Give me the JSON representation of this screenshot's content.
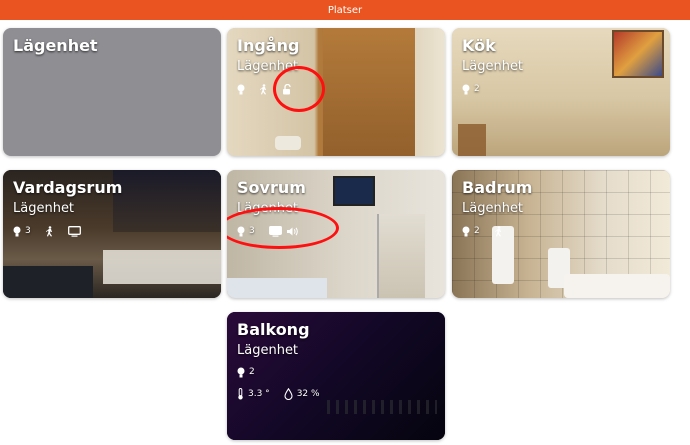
{
  "window": {
    "title": "Platser"
  },
  "colors": {
    "titlebar": "#e95420",
    "annotation": "#ff1010",
    "empty_card": "#8e8e93"
  },
  "cards": [
    {
      "name": "Lägenhet",
      "sub": "",
      "icons": []
    },
    {
      "name": "Ingång",
      "sub": "Lägenhet",
      "icons": [
        "lightbulb-icon",
        "motion-icon",
        "unlocked-padlock-icon"
      ]
    },
    {
      "name": "Kök",
      "sub": "Lägenhet",
      "lights": "2"
    },
    {
      "name": "Vardagsrum",
      "sub": "Lägenhet",
      "lights": "3",
      "icons": [
        "lightbulb-icon",
        "motion-icon",
        "tv-icon"
      ]
    },
    {
      "name": "Sovrum",
      "sub": "Lägenhet",
      "lights": "3",
      "icons": [
        "lightbulb-icon",
        "tv-icon",
        "speaker-icon"
      ]
    },
    {
      "name": "Badrum",
      "sub": "Lägenhet",
      "lights": "2",
      "icons": [
        "lightbulb-icon",
        "motion-icon"
      ]
    },
    {
      "name": "Balkong",
      "sub": "Lägenhet",
      "lights": "2",
      "temperature": "3.3 °",
      "humidity": "32 %"
    }
  ]
}
